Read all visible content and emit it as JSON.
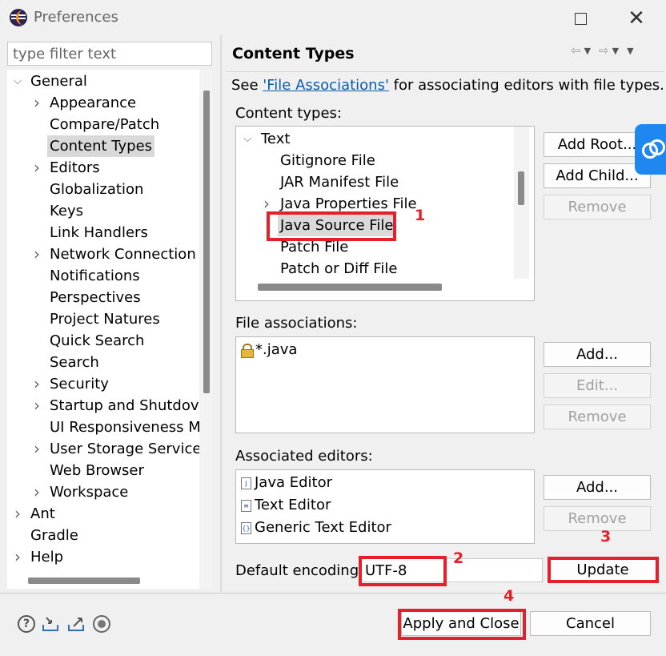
{
  "window": {
    "title": "Preferences",
    "maximize_label": "",
    "close_label": "✕"
  },
  "filter": {
    "placeholder": "type filter text"
  },
  "tree": {
    "items": [
      {
        "label": "General",
        "level": 0,
        "state": "expanded"
      },
      {
        "label": "Appearance",
        "level": 1,
        "state": "collapsed"
      },
      {
        "label": "Compare/Patch",
        "level": 1,
        "state": "leaf"
      },
      {
        "label": "Content Types",
        "level": 1,
        "state": "leaf",
        "selected": true
      },
      {
        "label": "Editors",
        "level": 1,
        "state": "collapsed"
      },
      {
        "label": "Globalization",
        "level": 1,
        "state": "leaf"
      },
      {
        "label": "Keys",
        "level": 1,
        "state": "leaf"
      },
      {
        "label": "Link Handlers",
        "level": 1,
        "state": "leaf"
      },
      {
        "label": "Network Connection",
        "level": 1,
        "state": "collapsed"
      },
      {
        "label": "Notifications",
        "level": 1,
        "state": "leaf"
      },
      {
        "label": "Perspectives",
        "level": 1,
        "state": "leaf"
      },
      {
        "label": "Project Natures",
        "level": 1,
        "state": "leaf"
      },
      {
        "label": "Quick Search",
        "level": 1,
        "state": "leaf"
      },
      {
        "label": "Search",
        "level": 1,
        "state": "leaf"
      },
      {
        "label": "Security",
        "level": 1,
        "state": "collapsed"
      },
      {
        "label": "Startup and Shutdov",
        "level": 1,
        "state": "collapsed"
      },
      {
        "label": "UI Responsiveness M",
        "level": 1,
        "state": "leaf"
      },
      {
        "label": "User Storage Service",
        "level": 1,
        "state": "collapsed"
      },
      {
        "label": "Web Browser",
        "level": 1,
        "state": "leaf"
      },
      {
        "label": "Workspace",
        "level": 1,
        "state": "collapsed"
      },
      {
        "label": "Ant",
        "level": 0,
        "state": "collapsed"
      },
      {
        "label": "Gradle",
        "level": 0,
        "state": "leaf"
      },
      {
        "label": "Help",
        "level": 0,
        "state": "collapsed"
      }
    ]
  },
  "page": {
    "title": "Content Types",
    "see_prefix": "See ",
    "see_link": "'File Associations'",
    "see_suffix": " for associating editors with file types.",
    "nav": {
      "back": "⇦",
      "forward": "⇨",
      "dropdown": "▼",
      "menu": "▼"
    }
  },
  "content_types": {
    "label": "Content types:",
    "items": [
      {
        "label": "Text",
        "level": 0,
        "state": "expanded"
      },
      {
        "label": "Gitignore File",
        "level": 1,
        "state": "leaf"
      },
      {
        "label": "JAR Manifest File",
        "level": 1,
        "state": "leaf"
      },
      {
        "label": "Java Properties File",
        "level": 1,
        "state": "collapsed"
      },
      {
        "label": "Java Source File",
        "level": 1,
        "state": "leaf",
        "selected": true
      },
      {
        "label": "Patch File",
        "level": 1,
        "state": "leaf"
      },
      {
        "label": "Patch or Diff File",
        "level": 1,
        "state": "leaf"
      }
    ],
    "buttons": {
      "add_root": "Add Root...",
      "add_child": "Add Child...",
      "remove": "Remove"
    }
  },
  "file_associations": {
    "label": "File associations:",
    "items": [
      {
        "label": "*.java",
        "icon": "lock-icon"
      }
    ],
    "buttons": {
      "add": "Add...",
      "edit": "Edit...",
      "remove": "Remove"
    }
  },
  "associated_editors": {
    "label": "Associated editors:",
    "items": [
      {
        "label": "Java Editor",
        "icon": "java-editor-icon"
      },
      {
        "label": "Text Editor",
        "icon": "text-editor-icon"
      },
      {
        "label": "Generic Text Editor",
        "icon": "generic-editor-icon"
      }
    ],
    "buttons": {
      "add": "Add...",
      "remove": "Remove"
    }
  },
  "encoding": {
    "label": "Default encoding:",
    "value": "UTF-8",
    "update_button": "Update"
  },
  "footer": {
    "apply_close": "Apply and Close",
    "cancel": "Cancel",
    "help_glyph": "?"
  },
  "annotations": [
    "1",
    "2",
    "3",
    "4"
  ],
  "colors": {
    "accent": "#e5202a",
    "link": "#0b5cad",
    "side_widget": "#1f87f0"
  }
}
